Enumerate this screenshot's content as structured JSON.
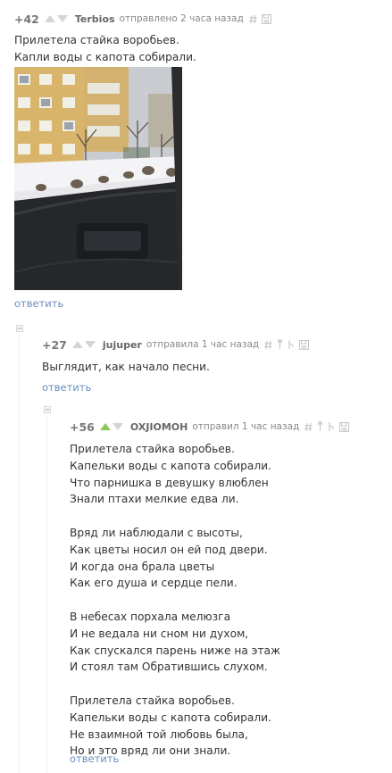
{
  "comments": [
    {
      "rating": "+42",
      "author": "Terbios",
      "meta": "отправлено 2 часа назад",
      "body": "Прилетела стайка воробьев.\nКапли воды с капота собирали.",
      "reply": "ответить"
    },
    {
      "rating": "+27",
      "author": "jujuper",
      "meta": "отправила 1 час назад",
      "body": "Выглядит, как начало песни.",
      "reply": "ответить"
    },
    {
      "rating": "+56",
      "author": "OXJIOMOH",
      "meta": "отправил 1 час назад",
      "body": "Прилетела стайка воробьев.\nКапельки воды с капота собирали.\nЧто парнишка в девушку влюблен\nЗнали птахи мелкие едва ли.\n\nВряд ли наблюдали с высоты,\nКак цветы носил он ей под двери.\nИ когда она брала цветы\nКак его душа и сердце пели.\n\nВ небесах порхала мелюзга\nИ не ведала ни сном ни духом,\nКак спускался парень ниже на этаж\nИ стоял там Обратившись слухом.\n\nПрилетела стайка воробьев.\nКапельки воды с капота собирали.\nНе взаимной той любовь была,\nНо и это вряд ли они знали.",
      "reply": "ответить"
    }
  ],
  "photo_subject": "sparrows-on-car-hood-winter",
  "colors": {
    "reply_link": "#6b8fbe",
    "upvote_active": "#8ac858",
    "vote_inactive": "#d4d4d4"
  }
}
